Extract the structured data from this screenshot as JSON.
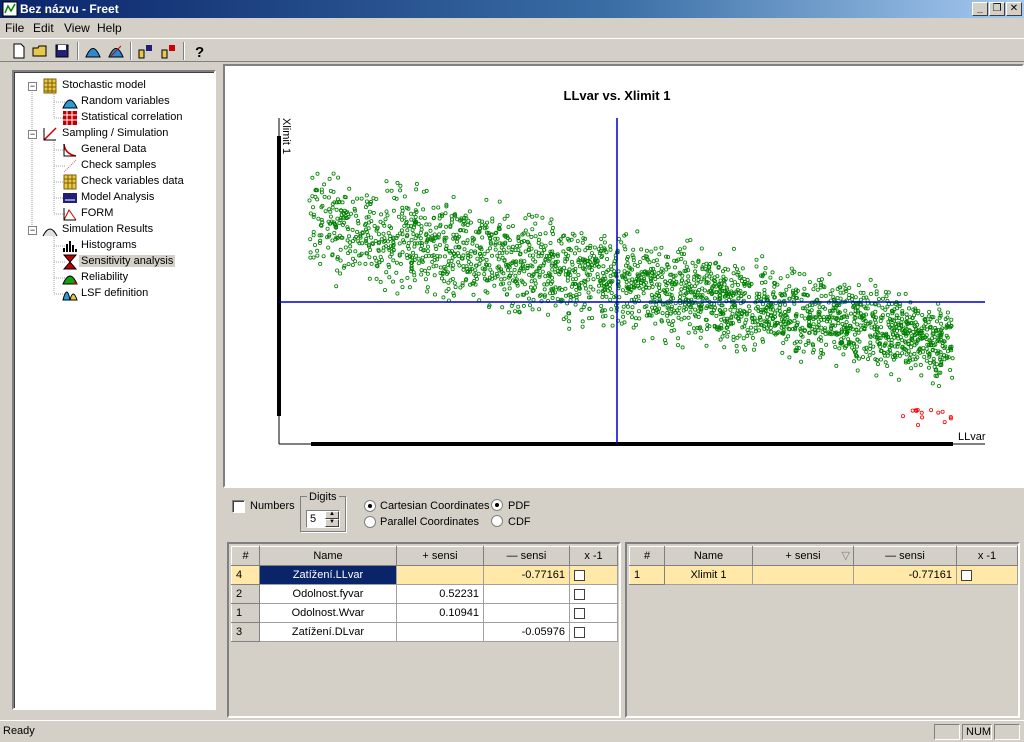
{
  "window": {
    "title": "Bez názvu - Freet",
    "min": "_",
    "restore": "❐",
    "close": "✕"
  },
  "menu": [
    "File",
    "Edit",
    "View",
    "Help"
  ],
  "tree": {
    "stochastic_model": "Stochastic model",
    "random_variables": "Random variables",
    "statistical_correlation": "Statistical correlation",
    "sampling_simulation": "Sampling / Simulation",
    "general_data": "General Data",
    "check_samples": "Check samples",
    "check_variables_data": "Check variables data",
    "model_analysis": "Model Analysis",
    "form": "FORM",
    "simulation_results": "Simulation Results",
    "histograms": "Histograms",
    "sensitivity_analysis": "Sensitivity analysis",
    "reliability": "Reliability",
    "lsf_definition": "LSF definition"
  },
  "chart_data": {
    "type": "scatter",
    "title": "LLvar vs. Xlimit 1",
    "xlabel": "LLvar",
    "ylabel": "Xlimit 1",
    "series": [
      {
        "name": "",
        "color": "#008000",
        "description_trend": "negative correlation",
        "x_range_norm": [
          0,
          1
        ],
        "y_start_band": [
          0.03,
          0.57
        ],
        "y_end_band": [
          0.55,
          0.93
        ]
      },
      {
        "name": "",
        "color": "#ff0000",
        "note": "failure points at lower-right"
      }
    ],
    "correlation": -0.77161,
    "grid": false
  },
  "controls": {
    "numbers_label": "Numbers",
    "digits_label": "Digits",
    "digits_value": "5",
    "cartesian_label": "Cartesian Coordinates",
    "parallel_label": "Parallel Coordinates",
    "pdf_label": "PDF",
    "cdf_label": "CDF"
  },
  "left_table": {
    "headers": [
      "#",
      "Name",
      "+ sensi",
      "— sensi",
      "x -1"
    ],
    "rows": [
      {
        "idx": "4",
        "name": "Zatížení.LLvar",
        "plus": "",
        "minus": "-0.77161"
      },
      {
        "idx": "2",
        "name": "Odolnost.fyvar",
        "plus": "0.52231",
        "minus": ""
      },
      {
        "idx": "1",
        "name": "Odolnost.Wvar",
        "plus": "0.10941",
        "minus": ""
      },
      {
        "idx": "3",
        "name": "Zatížení.DLvar",
        "plus": "",
        "minus": "-0.05976"
      }
    ]
  },
  "right_table": {
    "headers": [
      "#",
      "Name",
      "+ sensi",
      "— sensi",
      "x -1"
    ],
    "sort_indicator": "▽",
    "rows": [
      {
        "idx": "1",
        "name": "Xlimit 1",
        "plus": "",
        "minus": "-0.77161"
      }
    ]
  },
  "status": {
    "text": "Ready",
    "num": "NUM"
  },
  "colors": {
    "accent": "#0a246a",
    "highlight": "#ffe8a8",
    "scatter": "#008000",
    "axis": "#0000cc"
  }
}
